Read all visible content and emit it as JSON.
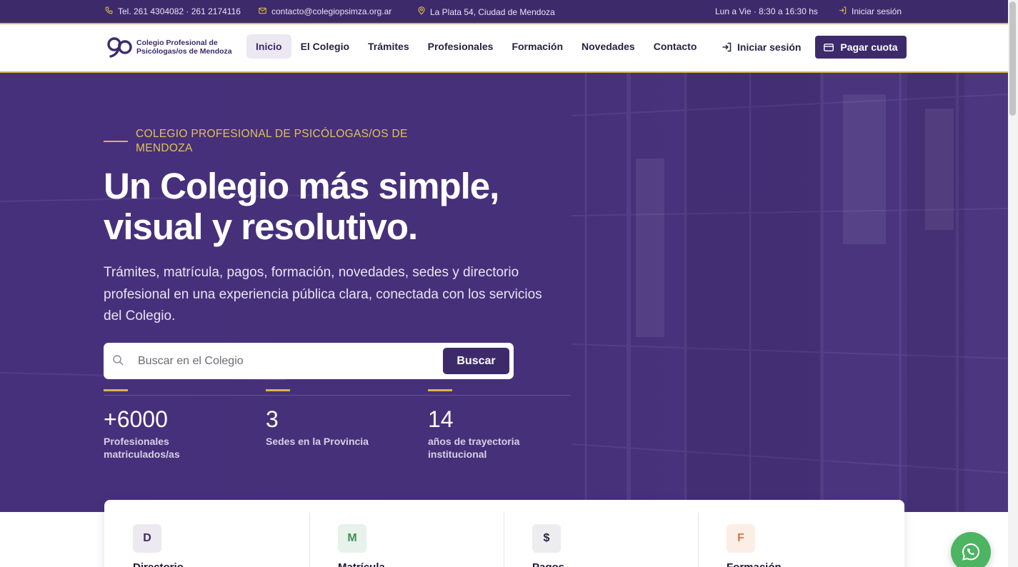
{
  "topbar": {
    "phone": "Tel. 261 4304082 · 261 2174116",
    "email": "contacto@colegiopsimza.org.ar",
    "address": "La Plata 54, Ciudad de Mendoza",
    "hours": "Lun a Vie · 8:30 a 16:30 hs",
    "login": "Iniciar sesión"
  },
  "nav": {
    "logo_line1": "Colegio Profesional de",
    "logo_line2": "Psicólogas/os de Mendoza",
    "links": [
      "Inicio",
      "El Colegio",
      "Trámites",
      "Profesionales",
      "Formación",
      "Novedades",
      "Contacto"
    ],
    "active": "Inicio",
    "login": "Iniciar sesión",
    "pay": "Pagar cuota"
  },
  "hero": {
    "eyebrow": "COLEGIO PROFESIONAL DE PSICÓLOGAS/OS DE MENDOZA",
    "title_line1": "Un Colegio más simple,",
    "title_line2": "visual y resolutivo.",
    "lead": "Trámites, matrícula, pagos, formación, novedades, sedes y directorio profesional en una experiencia pública clara, conectada con los servicios del Colegio.",
    "search_placeholder": "Buscar en el Colegio",
    "search_button": "Buscar",
    "stats": [
      {
        "number": "+6000",
        "label": "Profesionales matriculados/as"
      },
      {
        "number": "3",
        "label": "Sedes en la Provincia"
      },
      {
        "number": "14",
        "label": "años de trayectoria institucional"
      }
    ]
  },
  "cards": [
    {
      "letter": "D",
      "title": "Directorio",
      "badge_bg": "#ece9f1",
      "badge_fg": "#3d2a6b"
    },
    {
      "letter": "M",
      "title": "Matrícula",
      "badge_bg": "#e6f2ea",
      "badge_fg": "#3f8f5a"
    },
    {
      "letter": "$",
      "title": "Pagos",
      "badge_bg": "#ededf0",
      "badge_fg": "#2a2140"
    },
    {
      "letter": "F",
      "title": "Formación",
      "badge_bg": "#fbeee6",
      "badge_fg": "#d07a45"
    }
  ],
  "colors": {
    "brand": "#3d2a6b",
    "gold": "#d8b64b",
    "whatsapp": "#4db462"
  }
}
